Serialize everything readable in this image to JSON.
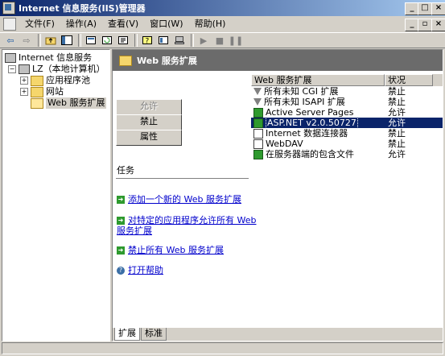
{
  "window": {
    "title": "Internet 信息服务(IIS)管理器",
    "controls": [
      "_",
      "□",
      "×"
    ],
    "mdi_controls": [
      "_",
      "▫",
      "×"
    ]
  },
  "menu": [
    "文件(F)",
    "操作(A)",
    "查看(V)",
    "窗口(W)",
    "帮助(H)"
  ],
  "toolbar": {
    "icons": [
      "back-icon",
      "forward-icon",
      "up-folder-icon",
      "show-tree-icon",
      "properties-icon",
      "refresh-icon",
      "export-icon",
      "help-icon",
      "snap-in-icon",
      "computer-icon",
      "play-icon",
      "stop-icon",
      "pause-icon"
    ]
  },
  "tree": {
    "root": "Internet 信息服务",
    "computer": "LZ（本地计算机）",
    "children": [
      "应用程序池",
      "网站",
      "Web 服务扩展"
    ]
  },
  "main": {
    "header": "Web 服务扩展",
    "buttons": {
      "allow": "允许",
      "prohibit": "禁止",
      "properties": "属性"
    },
    "tasks_title": "任务",
    "tasks": {
      "add_new": "添加一个新的 Web 服务扩展",
      "allow_all_line1": "对特定的应用程序允许所有 Web",
      "allow_all_line2": "服务扩展",
      "prohibit_all": "禁止所有 Web 服务扩展",
      "open_help": "打开帮助"
    }
  },
  "list": {
    "columns": {
      "name": "Web 服务扩展",
      "status": "状况"
    },
    "rows": [
      {
        "name": "所有未知 CGI 扩展",
        "status": "禁止",
        "icon": "filter-icon",
        "selected": false
      },
      {
        "name": "所有未知 ISAPI 扩展",
        "status": "禁止",
        "icon": "filter-icon",
        "selected": false
      },
      {
        "name": "Active Server Pages",
        "status": "允许",
        "icon": "extension-allowed-icon",
        "selected": false
      },
      {
        "name": "ASP.NET v2.0.50727",
        "status": "允许",
        "icon": "extension-allowed-icon",
        "selected": true
      },
      {
        "name": "Internet 数据连接器",
        "status": "禁止",
        "icon": "extension-icon",
        "selected": false
      },
      {
        "name": "WebDAV",
        "status": "禁止",
        "icon": "extension-icon",
        "selected": false
      },
      {
        "name": "在服务器端的包含文件",
        "status": "允许",
        "icon": "extension-allowed-icon",
        "selected": false
      }
    ]
  },
  "tabs": {
    "extended": "扩展",
    "standard": "标准"
  },
  "colors": {
    "title_start": "#0a246a",
    "title_end": "#a6caf0",
    "header_bg": "#6b6b6b",
    "selection": "#0a246a",
    "link": "#0000cc"
  }
}
